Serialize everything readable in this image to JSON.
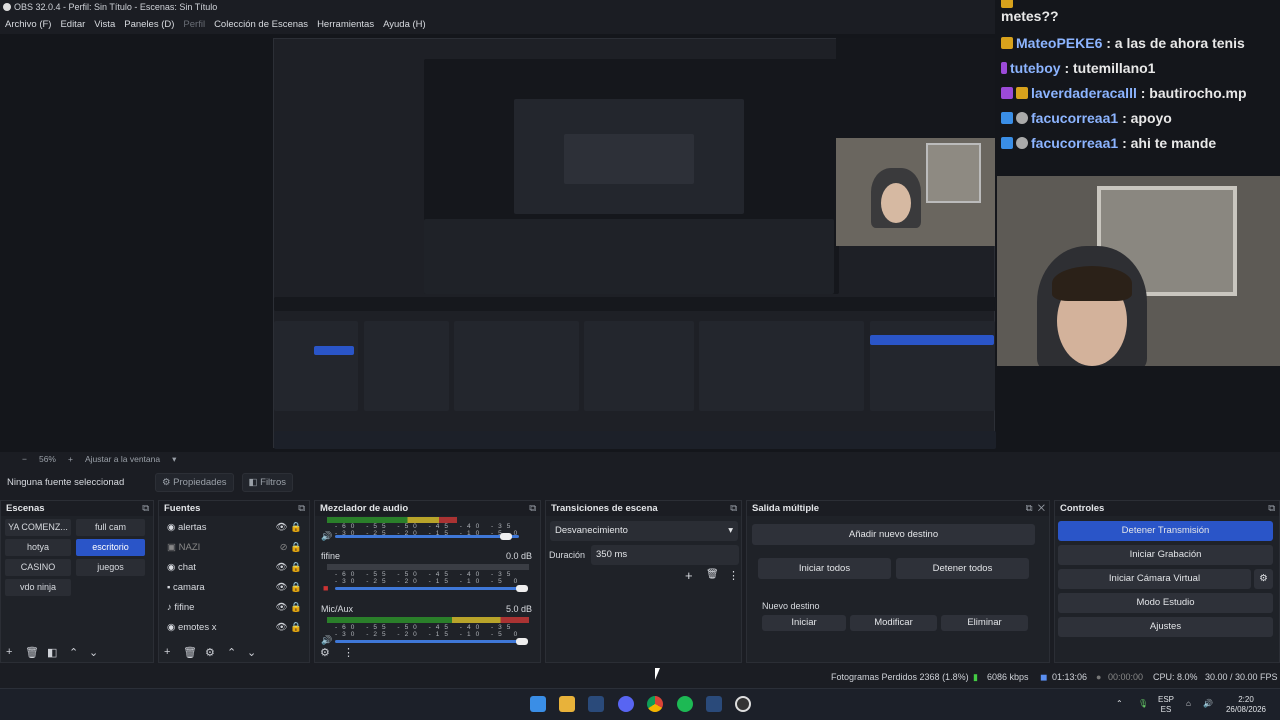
{
  "window": {
    "title": "OBS 32.0.4 - Perfil: Sin Título - Escenas: Sin Título"
  },
  "menu": [
    "Archivo (F)",
    "Editar",
    "Vista",
    "Paneles (D)",
    "Perfil",
    "Colección de Escenas",
    "Herramientas",
    "Ayuda (H)"
  ],
  "chat": {
    "lines": [
      {
        "user": "",
        "msg": "metes??",
        "top_prefix": "",
        "prefix": ""
      },
      {
        "user": "MateoPEKE6",
        "msg": ": a las de ahora tenis"
      },
      {
        "user": "tuteboy",
        "msg": ": tutemillano1"
      },
      {
        "user": "laverdaderacalll",
        "msg": ": bautirocho.mp"
      },
      {
        "user": "facucorreaa1",
        "msg": ": apoyo"
      },
      {
        "user": "facucorreaa1",
        "msg": ": ahi te mande"
      }
    ],
    "colors": {
      "user": "#8cb4ff",
      "badge_blue": "#3a8ee6",
      "badge_gold": "#d8a21c",
      "badge_purple": "#9b4ad8"
    }
  },
  "zoom": {
    "percent": "56%",
    "plus": "+",
    "fit": "Ajustar a la ventana"
  },
  "source_bar": {
    "none_selected": "Ninguna fuente seleccionad",
    "properties": "Propiedades",
    "filters": "Filtros"
  },
  "scenes": {
    "title": "Escenas",
    "items": [
      "YA COMENZ...",
      "full cam",
      "hotya",
      "escritorio",
      "CASINO",
      "juegos",
      "vdo ninja"
    ],
    "selected": "escritorio"
  },
  "sources": {
    "title": "Fuentes",
    "items": [
      {
        "name": "alertas",
        "visible": true
      },
      {
        "name": "NAZI",
        "visible": false
      },
      {
        "name": "chat",
        "visible": true
      },
      {
        "name": "camara",
        "visible": true
      },
      {
        "name": "fifine",
        "visible": true
      },
      {
        "name": "emotes x",
        "visible": true
      }
    ]
  },
  "mixer": {
    "title": "Mezclador de audio",
    "scale": "-60 -55 -50 -45 -40 -35 -30 -25 -20 -15 -10 -5 0",
    "channels": [
      {
        "name": "",
        "db": ""
      },
      {
        "name": "fifine",
        "db": "0.0 dB"
      },
      {
        "name": "Mic/Aux",
        "db": "5.0 dB"
      }
    ]
  },
  "transitions": {
    "title": "Transiciones de escena",
    "type": "Desvanecimiento",
    "duration_label": "Duración",
    "duration": "350 ms"
  },
  "multi": {
    "title": "Salida múltiple",
    "add": "Añadir nuevo destino",
    "start_all": "Iniciar todos",
    "stop_all": "Detener todos",
    "new_dest": "Nuevo destino",
    "start": "Iniciar",
    "modify": "Modificar",
    "delete": "Eliminar"
  },
  "controls": {
    "title": "Controles",
    "stop_stream": "Detener Transmisión",
    "start_rec": "Iniciar Grabación",
    "virtual_cam": "Iniciar Cámara Virtual",
    "studio": "Modo Estudio",
    "settings": "Ajustes"
  },
  "status": {
    "dropped": "Fotogramas Perdidos 2368 (1.8%)",
    "kbps": "6086 kbps",
    "stream_time": "01:13:06",
    "rec_time": "00:00:00",
    "cpu": "CPU: 8.0%",
    "fps": "30.00 / 30.00 FPS"
  },
  "taskbar": {
    "lang": "ESP",
    "lang2": "ES",
    "time": "2:20",
    "date": "26/08/2026"
  },
  "colors": {
    "accent": "#2a55c8",
    "bg": "#1b1d23",
    "panel": "#1f2228"
  }
}
